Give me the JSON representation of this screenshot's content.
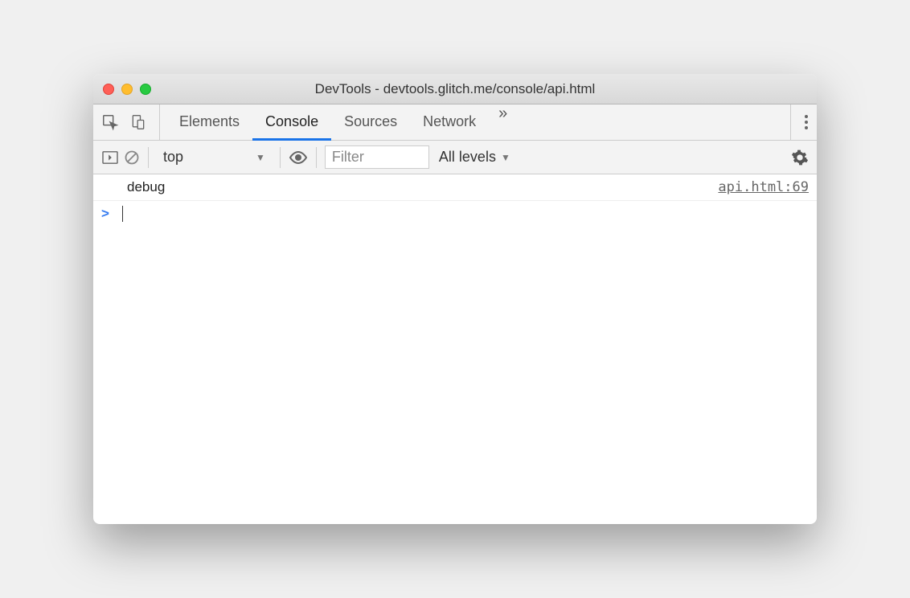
{
  "window": {
    "title": "DevTools - devtools.glitch.me/console/api.html"
  },
  "tabs": {
    "items": [
      "Elements",
      "Console",
      "Sources",
      "Network"
    ],
    "activeIndex": 1,
    "moreGlyph": "»"
  },
  "toolbar": {
    "context": "top",
    "filterPlaceholder": "Filter",
    "levels": "All levels"
  },
  "console": {
    "logs": [
      {
        "message": "debug",
        "source": "api.html:69"
      }
    ],
    "prompt": ">"
  }
}
